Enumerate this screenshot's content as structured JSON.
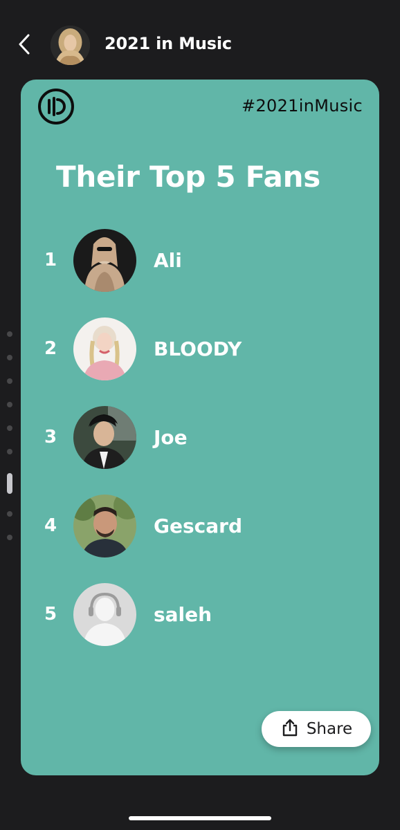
{
  "header": {
    "back_icon": "chevron-left-icon",
    "title": "2021 in Music"
  },
  "card": {
    "background_color": "#61b6a8",
    "logo_icon": "anghami-logo-icon",
    "hashtag": "#2021inMusic",
    "title": "Their Top 5 Fans",
    "fans": [
      {
        "rank": "1",
        "name": "Ali"
      },
      {
        "rank": "2",
        "name": "BLOODY"
      },
      {
        "rank": "3",
        "name": "Joe"
      },
      {
        "rank": "4",
        "name": "Gescard"
      },
      {
        "rank": "5",
        "name": "saleh"
      }
    ],
    "share": {
      "icon": "share-icon",
      "label": "Share"
    }
  }
}
